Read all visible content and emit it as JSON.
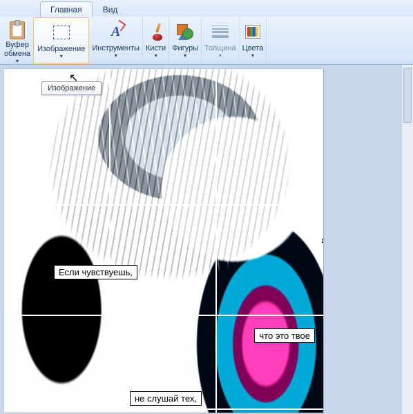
{
  "qat": {
    "doc_menu": "▾"
  },
  "tabs": {
    "main": "Главная",
    "view": "Вид"
  },
  "ribbon": {
    "clipboard": {
      "label": "Буфер\nобмена",
      "caret": "▾"
    },
    "image": {
      "label": "Изображение",
      "caret": "▾"
    },
    "tools": {
      "label": "Инструменты",
      "caret": "▾"
    },
    "brushes": {
      "label": "Кисти",
      "caret": "▾"
    },
    "shapes": {
      "label": "Фигуры",
      "caret": "▾"
    },
    "thickness": {
      "label": "Толщина",
      "caret": "▾"
    },
    "colors": {
      "label": "Цвета",
      "caret": "▾"
    }
  },
  "tooltip": {
    "image_group": "Изображение"
  },
  "canvas_overlays": {
    "caption1": "Если чувствуешь,",
    "caption2": "что это твое",
    "caption3": "не слушай тех,"
  }
}
